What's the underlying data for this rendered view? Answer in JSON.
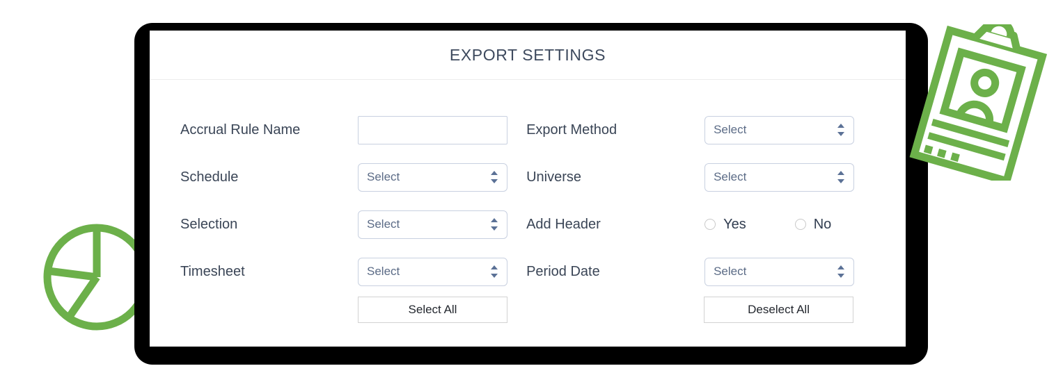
{
  "header": {
    "title": "EXPORT SETTINGS"
  },
  "colors": {
    "accent_green": "#6cb04a",
    "title_navy": "#3e4a5e",
    "label_navy": "#3a4556",
    "select_text": "#5b6b86",
    "field_border": "#c8d0e0",
    "button_border": "#d2d2d2",
    "frame_black": "#000000"
  },
  "form": {
    "rows": [
      {
        "left": {
          "label": "Accrual Rule Name",
          "control": "text",
          "value": "",
          "placeholder": ""
        },
        "right": {
          "label": "Export Method",
          "control": "select",
          "value": "Select"
        }
      },
      {
        "left": {
          "label": "Schedule",
          "control": "select",
          "value": "Select"
        },
        "right": {
          "label": "Universe",
          "control": "select",
          "value": "Select"
        }
      },
      {
        "left": {
          "label": "Selection",
          "control": "select",
          "value": "Select"
        },
        "right": {
          "label": "Add Header",
          "control": "radio",
          "options": [
            "Yes",
            "No"
          ],
          "selected": ""
        }
      },
      {
        "left": {
          "label": "Timesheet",
          "control": "select",
          "value": "Select"
        },
        "right": {
          "label": "Period Date",
          "control": "select",
          "value": "Select"
        }
      }
    ]
  },
  "buttons": {
    "select_all": "Select All",
    "deselect_all": "Deselect All"
  },
  "decorations": {
    "pie_chart_icon": "pie-chart-icon",
    "clipboard_icon": "clipboard-person-icon"
  }
}
